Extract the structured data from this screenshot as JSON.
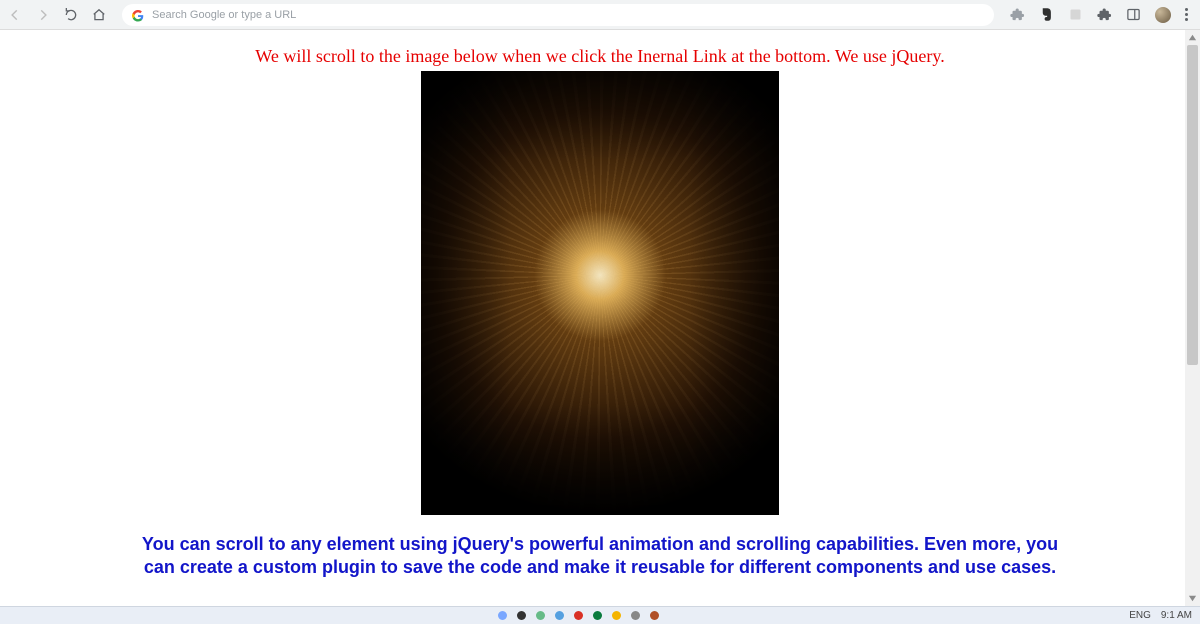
{
  "toolbar": {
    "omnibox_placeholder": "Search Google or type a URL"
  },
  "page": {
    "red_caption": "We will scroll to the image below when we click the Inernal Link at the bottom. We use jQuery.",
    "blue_paragraph": "You can scroll to any element using jQuery's powerful animation and scrolling capabilities. Even more, you can create a custom plugin to save the code and make it reusable for different components and use cases."
  },
  "taskbar": {
    "lang": "ENG",
    "time": "9:1 AM"
  }
}
